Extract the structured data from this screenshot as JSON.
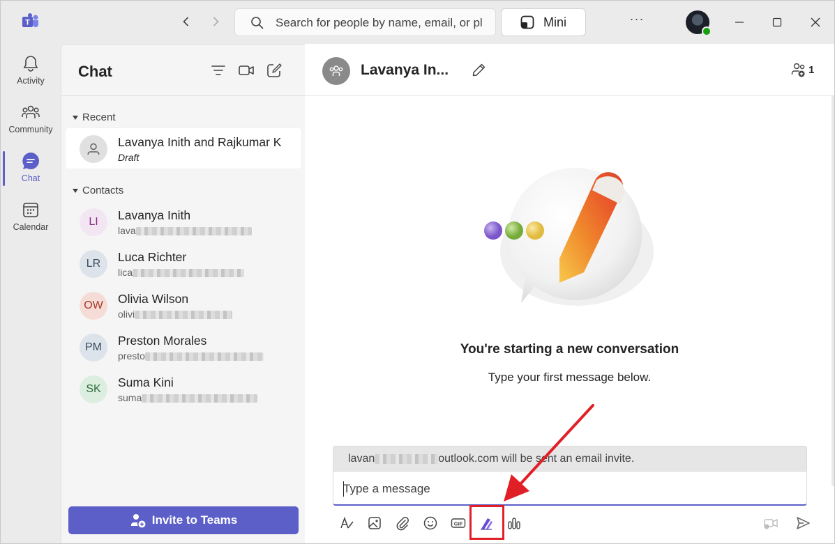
{
  "titlebar": {
    "search_placeholder": "Search for people by name, email, or pl",
    "mini_label": "Mini",
    "more_label": "···"
  },
  "rail": {
    "items": [
      {
        "label": "Activity",
        "icon": "bell-icon"
      },
      {
        "label": "Community",
        "icon": "community-icon"
      },
      {
        "label": "Chat",
        "icon": "chat-icon",
        "active": true
      },
      {
        "label": "Calendar",
        "icon": "calendar-icon"
      }
    ]
  },
  "chatlist": {
    "title": "Chat",
    "recent_label": "Recent",
    "contacts_label": "Contacts",
    "recent": [
      {
        "name": "Lavanya Inith and Rajkumar K",
        "sub": "Draft"
      }
    ],
    "contacts": [
      {
        "initials": "LI",
        "name": "Lavanya Inith",
        "sub_prefix": "lava",
        "bg": "#f3e6f3",
        "fg": "#8a2a80"
      },
      {
        "initials": "LR",
        "name": "Luca Richter",
        "sub_prefix": "lica",
        "bg": "#dde3ea",
        "fg": "#3a4b5c"
      },
      {
        "initials": "OW",
        "name": "Olivia Wilson",
        "sub_prefix": "olivi",
        "bg": "#f6dcd6",
        "fg": "#a33b27"
      },
      {
        "initials": "PM",
        "name": "Preston Morales",
        "sub_prefix": "presto",
        "bg": "#dde3ea",
        "fg": "#3a4b5c"
      },
      {
        "initials": "SK",
        "name": "Suma Kini",
        "sub_prefix": "suma",
        "bg": "#dceee0",
        "fg": "#2b6b3a"
      }
    ],
    "invite_label": "Invite to Teams"
  },
  "main": {
    "title": "Lavanya In...",
    "participant_count": "1",
    "empty_title": "You're starting a new conversation",
    "empty_sub": "Type your first message below.",
    "notice_prefix": "lavan",
    "notice_suffix": "outlook.com will be sent an email invite.",
    "compose_placeholder": "Type a message"
  },
  "colors": {
    "brand": "#5b5fc7",
    "highlight": "#e01f26"
  }
}
